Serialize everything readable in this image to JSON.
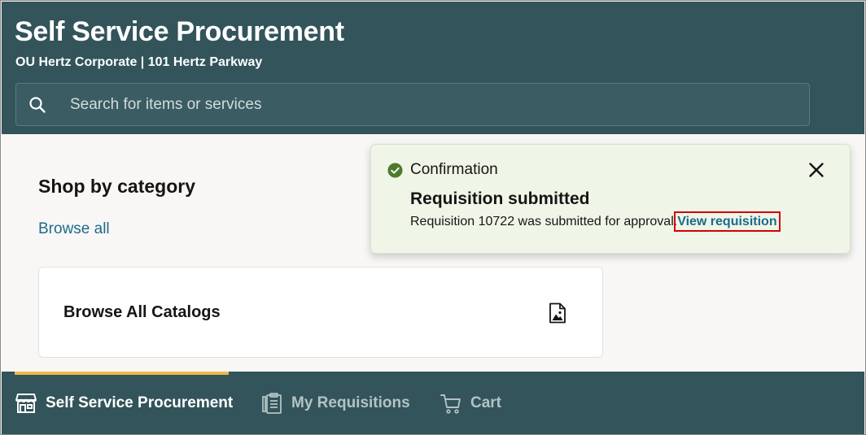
{
  "header": {
    "title": "Self Service Procurement",
    "org": "OU Hertz Corporate | 101 Hertz Parkway",
    "search": {
      "placeholder": "Search for items or services",
      "value": ""
    }
  },
  "main": {
    "section_title": "Shop by category",
    "browse_all": "Browse all",
    "catalog_card": {
      "title": "Browse All Catalogs",
      "icon": "image-file-icon"
    }
  },
  "toast": {
    "heading": "Confirmation",
    "title": "Requisition submitted",
    "message": "Requisition 10722 was submitted for approval.",
    "link": "View requisition",
    "status_color": "#4c7a2c"
  },
  "bottom_nav": {
    "items": [
      {
        "label": "Self Service Procurement",
        "icon": "store-icon",
        "active": true
      },
      {
        "label": "My Requisitions",
        "icon": "clipboard-icon",
        "active": false
      },
      {
        "label": "Cart",
        "icon": "cart-icon",
        "active": false
      }
    ],
    "active_color": "#e9b949"
  },
  "colors": {
    "header_bg": "#32545a",
    "link": "#1d6b8c",
    "toast_bg": "#eff6e8",
    "highlight": "#d40000"
  }
}
